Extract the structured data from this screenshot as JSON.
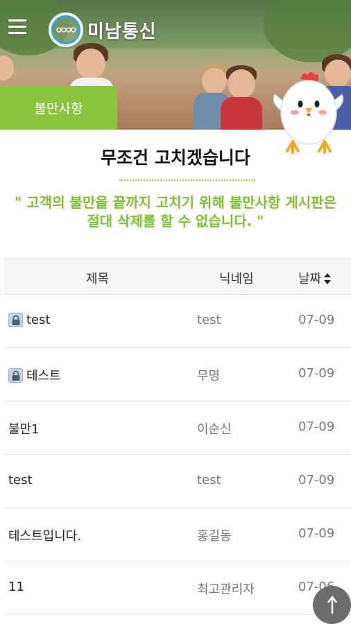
{
  "header": {
    "menu_icon": "hamburger-menu-icon",
    "logo_text": "미남통신",
    "logo_icon": "minam-logo-ring-icon"
  },
  "category_tab": "불만사항",
  "mascot_icon": "chicken-mascot-icon",
  "headline": "무조건 고치겠습니다",
  "subtitle": "\" 고객의 불만을 끝까지 고치기 위해 불만사항 게시판은 절대 삭제를 할 수 없습니다. \"",
  "board": {
    "columns": {
      "title": "제목",
      "nickname": "닉네임",
      "date": "날짜"
    },
    "sort_icon": "sort-updown-icon",
    "rows": [
      {
        "locked": true,
        "title": "test",
        "nickname": "test",
        "date": "07-09"
      },
      {
        "locked": true,
        "title": "테스트",
        "nickname": "무명",
        "date": "07-09"
      },
      {
        "locked": false,
        "title": "불만1",
        "nickname": "이순신",
        "date": "07-09"
      },
      {
        "locked": false,
        "title": "test",
        "nickname": "test",
        "date": "07-09"
      },
      {
        "locked": false,
        "title": "테스트입니다.",
        "nickname": "홍길동",
        "date": "07-09"
      },
      {
        "locked": false,
        "title": "11",
        "nickname": "최고관리자",
        "date": "07-06"
      }
    ]
  },
  "scroll_top_icon": "arrow-up-icon",
  "colors": {
    "accent_green": "#8bc53f",
    "quote_green": "#7bbf2f",
    "top_button": "#6d6d6d"
  }
}
